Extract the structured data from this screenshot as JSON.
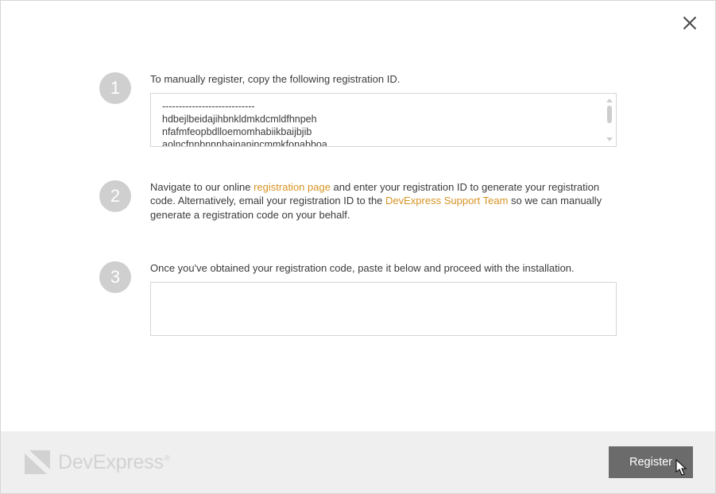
{
  "steps": {
    "one": {
      "num": "1",
      "instr": "To manually register, copy the following registration ID.",
      "reg_id": "----------------------------\nhdbejlbeidajihbnkldmkdcmldfhnpeh\nnfafmfeopbdlloemomhabiikbaijbjib\naolncfnnbnnnbainanincmmkfonabboa"
    },
    "two": {
      "num": "2",
      "pre": "Navigate to our online ",
      "link1": "registration page",
      "mid": " and enter your registration ID to generate your registration code. Alternatively, email your registration ID to the ",
      "link2": "DevExpress Support Team",
      "post": " so we can manually generate a registration code on your behalf."
    },
    "three": {
      "num": "3",
      "instr": "Once you've obtained your registration code, paste it below and proceed with the installation."
    }
  },
  "footer": {
    "brand_bold": "Dev",
    "brand_plain": "Express",
    "reg_mark": "®",
    "button": "Register"
  }
}
